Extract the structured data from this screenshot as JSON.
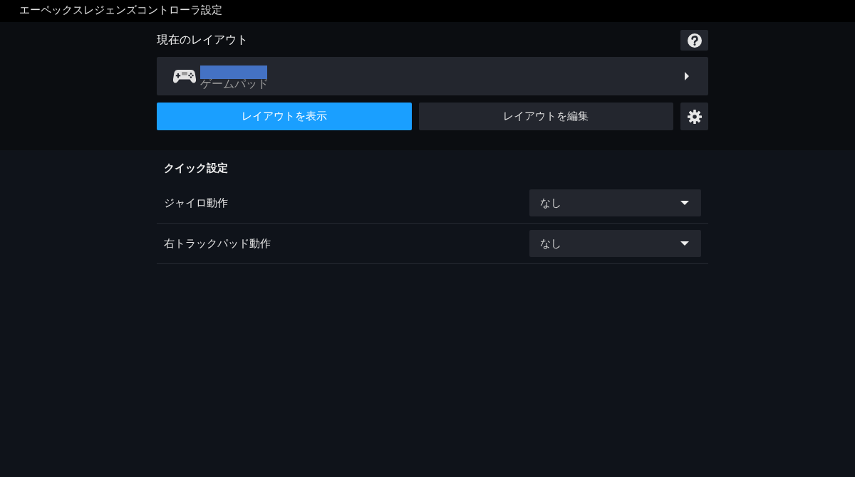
{
  "window": {
    "title": "エーペックスレジェンズコントローラ設定"
  },
  "current_layout": {
    "heading": "現在のレイアウト",
    "layout": {
      "type": "ゲームパッド"
    },
    "buttons": [
      {
        "label": "レイアウトを表示",
        "primary": true
      },
      {
        "label": "レイアウトを編集",
        "primary": false
      }
    ]
  },
  "quick_settings": {
    "heading": "クイック設定",
    "rows": [
      {
        "label": "ジャイロ動作",
        "value": "なし"
      },
      {
        "label": "右トラックパッド動作",
        "value": "なし"
      }
    ]
  }
}
